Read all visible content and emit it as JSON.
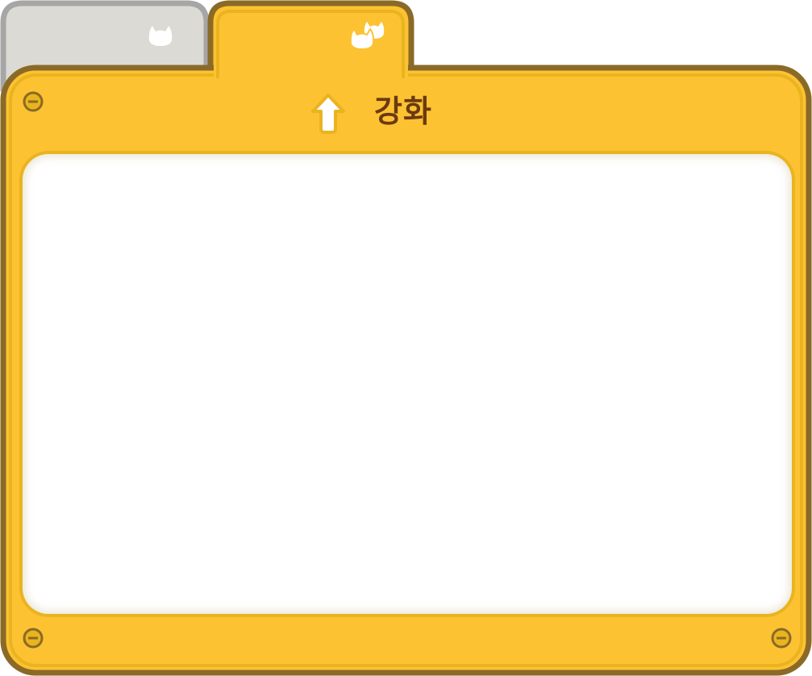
{
  "panel": {
    "title": "강화",
    "title_icon": "upgrade-arrow-icon"
  },
  "tabs": [
    {
      "icon": "cat-ear-icon",
      "state": "inactive"
    },
    {
      "icon": "two-cat-ears-icon",
      "state": "active"
    }
  ],
  "colors": {
    "frame_outline": "#8a6a26",
    "frame_fill": "#fcc232",
    "frame_inner_line": "#e9b41f",
    "inactive_tab_fill": "#dcdad4",
    "inactive_tab_outline": "#a6a6a6",
    "title_text": "#6b3a12",
    "content_bg": "#ffffff"
  },
  "screws": [
    "top-left",
    "bottom-left",
    "bottom-right"
  ]
}
